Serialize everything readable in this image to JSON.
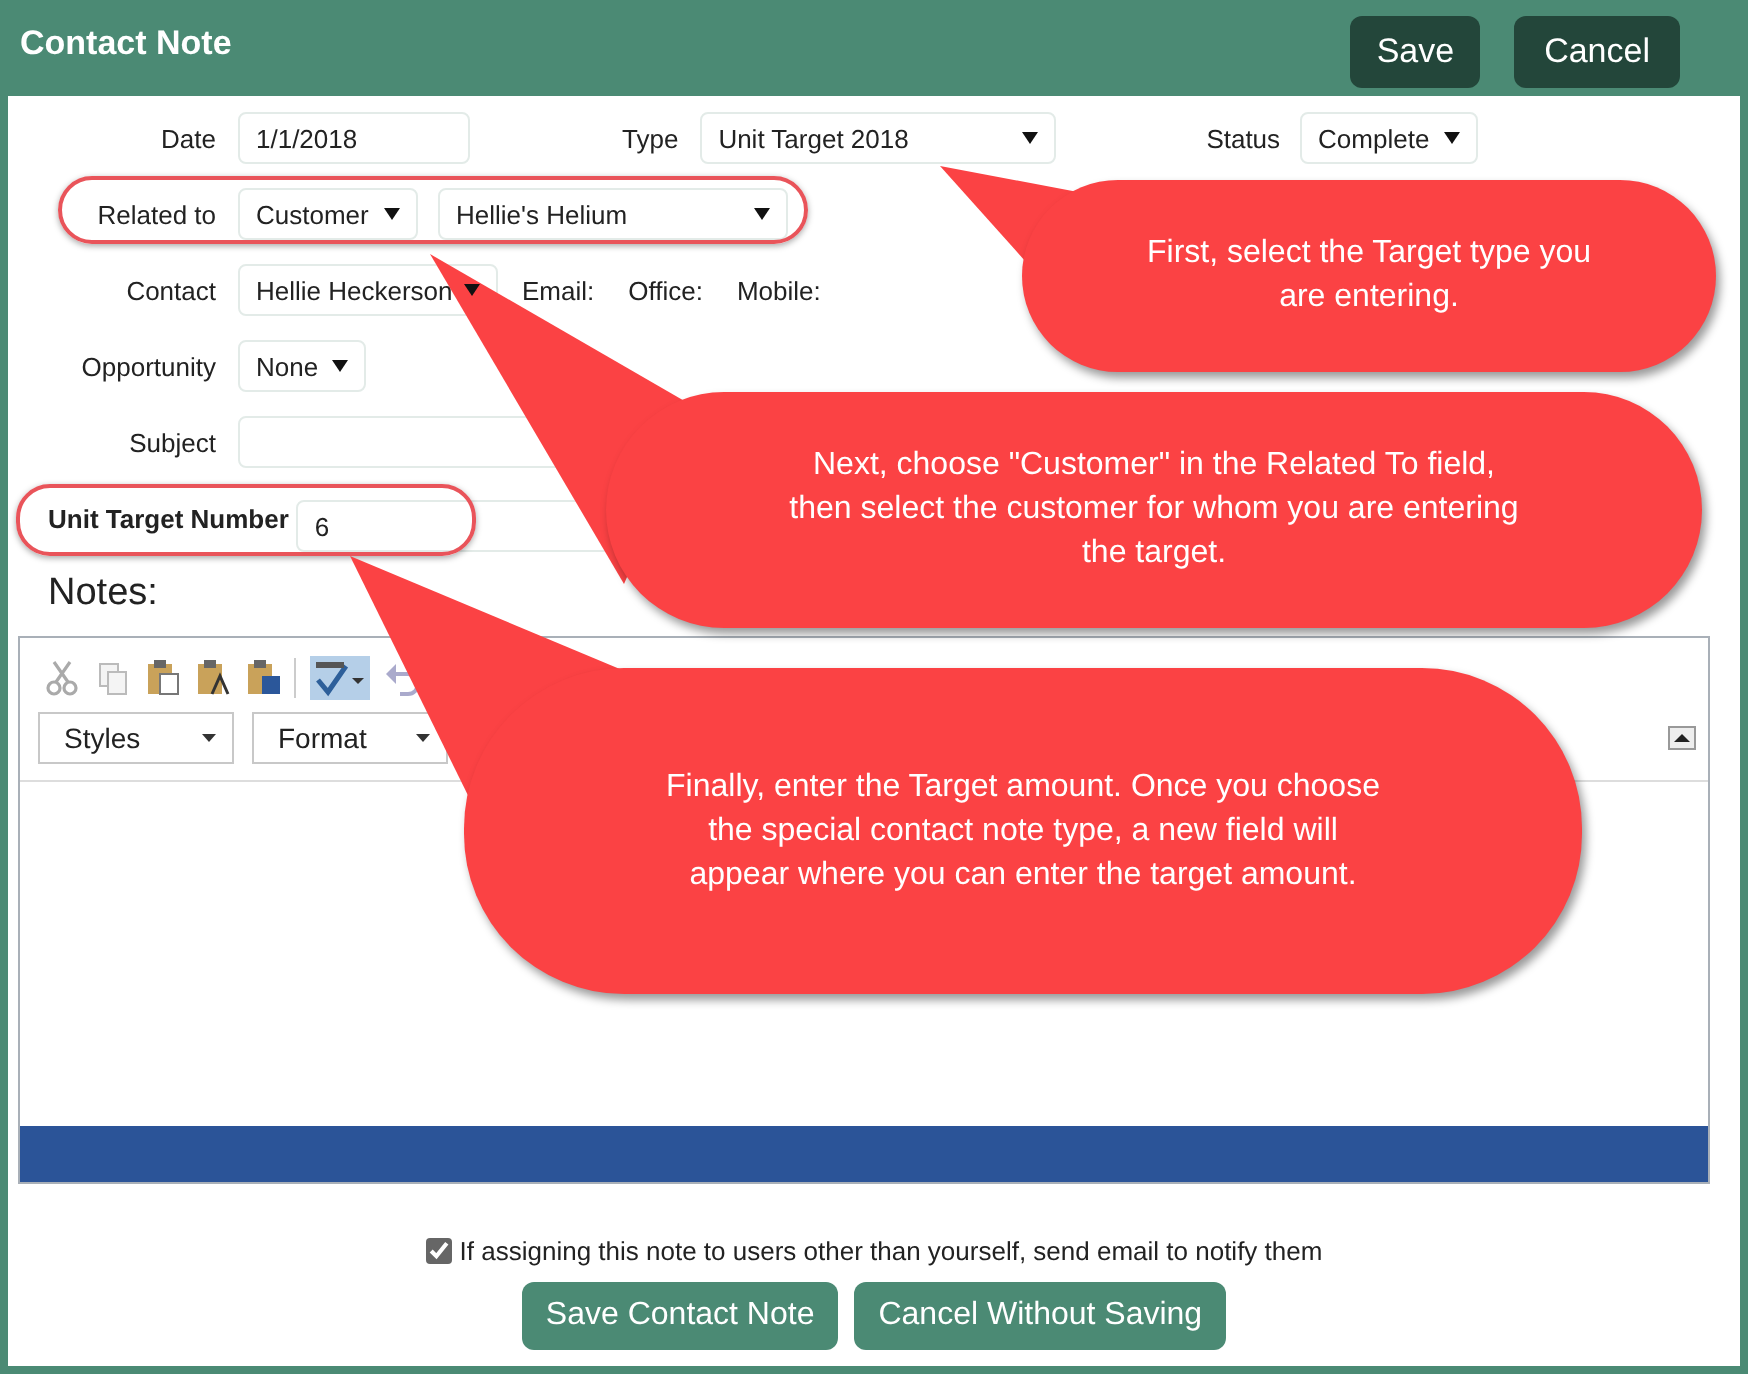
{
  "header": {
    "title": "Contact Note",
    "buttons": [
      "Save",
      "Cancel"
    ]
  },
  "rows": [
    {
      "kind": "standard",
      "highlighted": false,
      "items": [
        {
          "kind": "label",
          "text": "Date"
        },
        {
          "kind": "input",
          "value": "1/1/2018"
        },
        {
          "kind": "label",
          "text": "Type"
        },
        {
          "kind": "select",
          "value": "Unit Target 2018"
        },
        {
          "kind": "label",
          "text": "Status"
        },
        {
          "kind": "select",
          "value": "Complete"
        }
      ]
    },
    {
      "kind": "standard",
      "highlighted": true,
      "items": [
        {
          "kind": "label",
          "text": "Related to"
        },
        {
          "kind": "select",
          "value": "Customer"
        },
        {
          "kind": "select",
          "value": "Hellie's Helium"
        }
      ]
    },
    {
      "kind": "standard",
      "highlighted": false,
      "items": [
        {
          "kind": "label",
          "text": "Contact"
        },
        {
          "kind": "select",
          "value": "Hellie Heckerson"
        },
        {
          "kind": "info",
          "text": "Email:"
        },
        {
          "kind": "info",
          "text": "Office:"
        },
        {
          "kind": "info",
          "text": "Mobile:"
        }
      ]
    },
    {
      "kind": "standard",
      "highlighted": false,
      "items": [
        {
          "kind": "label",
          "text": "Opportunity"
        },
        {
          "kind": "select",
          "value": "None"
        }
      ]
    },
    {
      "kind": "standard",
      "highlighted": false,
      "items": [
        {
          "kind": "label",
          "text": "Subject"
        },
        {
          "kind": "input"
        }
      ]
    },
    {
      "kind": "strong",
      "highlighted": true,
      "items": [
        {
          "kind": "label",
          "text": "Unit Target Number"
        },
        {
          "kind": "input",
          "value": "6"
        }
      ]
    }
  ],
  "notes": {
    "heading": "Notes:",
    "dropdowns": [
      "Styles",
      "Format"
    ]
  },
  "notify": {
    "checked": true,
    "label": "If assigning this note to users other than yourself, send email to notify them"
  },
  "buttons": [
    "Save Contact Note",
    "Cancel Without Saving"
  ],
  "callouts": [
    "First, select the Target type you are entering.",
    "Next, choose \"Customer\" in the Related To field, then select the customer for whom you are entering the target.",
    "Finally, enter the Target amount.  Once you choose the special contact note type, a new field will appear where you can enter the target amount."
  ]
}
